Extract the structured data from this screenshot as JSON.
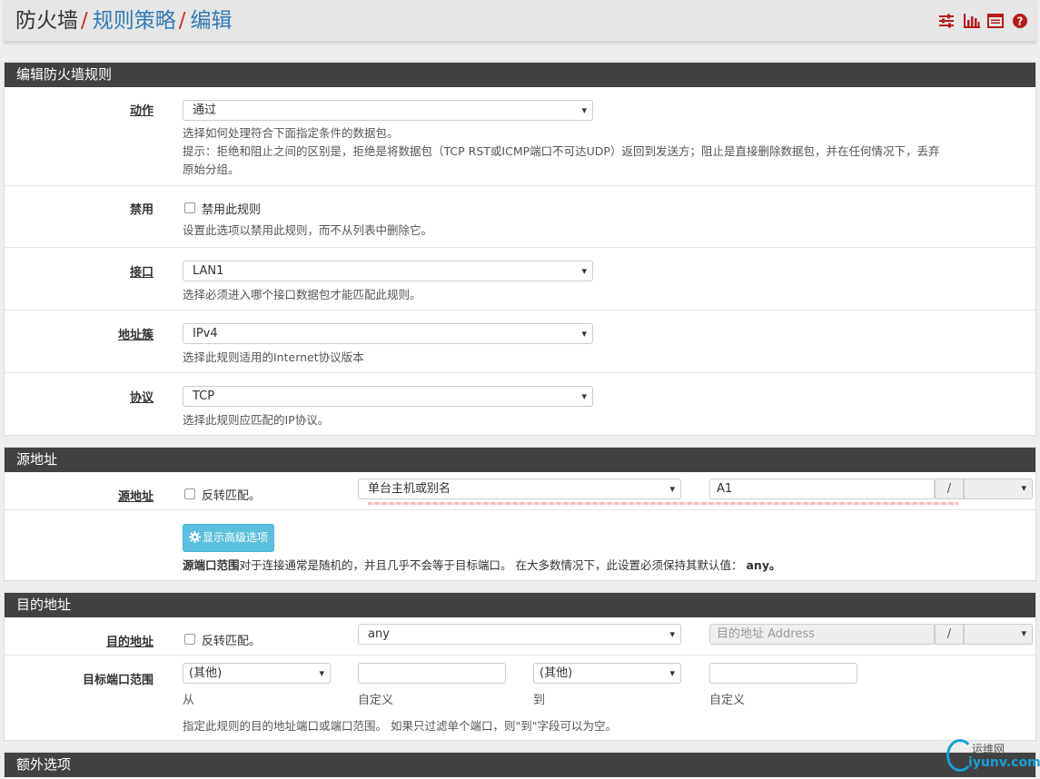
{
  "breadcrumb": {
    "root": "防火墙",
    "sep": "/",
    "level2": "规则策略",
    "level3": "编辑"
  },
  "top_icons": [
    "sliders-icon",
    "bar-chart-icon",
    "list-icon",
    "help-icon"
  ],
  "edit_panel": {
    "title": "编辑防火墙规则",
    "action": {
      "label": "动作",
      "value": "通过",
      "help1": "选择如何处理符合下面指定条件的数据包。",
      "help2": "提示：拒绝和阻止之间的区别是，拒绝是将数据包（TCP RST或ICMP端口不可达UDP）返回到发送方；阻止是直接删除数据包，并在任何情况下，丢弃",
      "help3": "原始分组。"
    },
    "disabled": {
      "label": "禁用",
      "checkbox_label": "禁用此规则",
      "help": "设置此选项以禁用此规则，而不从列表中删除它。"
    },
    "interface": {
      "label": "接口",
      "value": "LAN1",
      "help": "选择必须进入哪个接口数据包才能匹配此规则。"
    },
    "family": {
      "label": "地址簇",
      "value": "IPv4",
      "help": "选择此规则适用的Internet协议版本"
    },
    "protocol": {
      "label": "协议",
      "value": "TCP",
      "help": "选择此规则应匹配的IP协议。"
    }
  },
  "source_panel": {
    "title": "源地址",
    "label": "源地址",
    "invert_label": "反转匹配。",
    "type_value": "单台主机或别名",
    "address_value": "A1",
    "slash": "/",
    "advanced_button": "显示高级选项",
    "help_bold": "源端口范围",
    "help_text": "对于连接通常是随机的，并且几乎不会等于目标端口。 在大多数情况下，此设置必须保持其默认值：",
    "help_default": "any。"
  },
  "dest_panel": {
    "title": "目的地址",
    "label": "目的地址",
    "invert_label": "反转匹配。",
    "type_value": "any",
    "address_placeholder": "目的地址 Address",
    "slash": "/",
    "port_label": "目标端口范围",
    "from_select": "(其他)",
    "from_caption": "从",
    "from_custom_caption": "自定义",
    "to_select": "(其他)",
    "to_caption": "到",
    "to_custom_caption": "自定义",
    "help": "指定此规则的目的地址端口或端口范围。 如果只过滤单个端口，则\"到\"字段可以为空。"
  },
  "extra_panel": {
    "title": "额外选项"
  },
  "watermark": {
    "line1": "运维网",
    "line2": "iyunv.com"
  },
  "colors": {
    "header_bg": "#424242",
    "link": "#337ab7",
    "accent_red": "#c9302c",
    "info_button": "#5bc0de"
  }
}
